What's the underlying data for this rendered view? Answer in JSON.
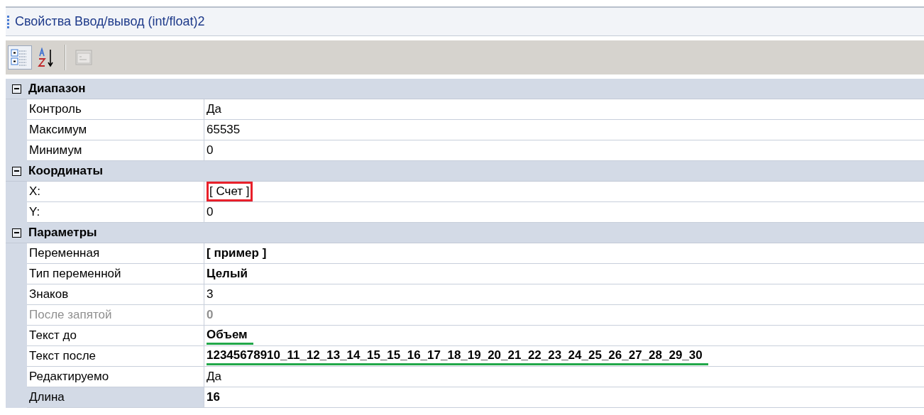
{
  "window": {
    "title": "Свойства Ввод/вывод (int/float)2"
  },
  "toolbar": [
    {
      "kind": "categorized",
      "selected": true,
      "disabled": false
    },
    {
      "kind": "alphabetical",
      "selected": false,
      "disabled": false
    },
    {
      "kind": "pages",
      "selected": false,
      "disabled": true
    }
  ],
  "categories": [
    {
      "name": "Диапазон",
      "expanded": true,
      "properties": [
        {
          "name": "Контроль",
          "value": "Да",
          "bold": false,
          "disabled": false,
          "selected": false
        },
        {
          "name": "Максимум",
          "value": "65535",
          "bold": false,
          "disabled": false,
          "selected": false
        },
        {
          "name": "Минимум",
          "value": "0",
          "bold": false,
          "disabled": false,
          "selected": false
        }
      ]
    },
    {
      "name": "Координаты",
      "expanded": true,
      "properties": [
        {
          "name": "X:",
          "value": "[ Счет ]",
          "bold": false,
          "disabled": false,
          "selected": false,
          "annotation": {
            "kind": "box",
            "color": "#e8202a"
          }
        },
        {
          "name": "Y:",
          "value": "0",
          "bold": false,
          "disabled": false,
          "selected": false
        }
      ]
    },
    {
      "name": "Параметры",
      "expanded": true,
      "properties": [
        {
          "name": "Переменная",
          "value": "[ пример ]",
          "bold": true,
          "disabled": false,
          "selected": false
        },
        {
          "name": "Тип переменной",
          "value": "Целый",
          "bold": true,
          "disabled": false,
          "selected": false
        },
        {
          "name": "Знаков",
          "value": "3",
          "bold": false,
          "disabled": false,
          "selected": false
        },
        {
          "name": "После запятой",
          "value": "0",
          "bold": true,
          "disabled": true,
          "selected": false
        },
        {
          "name": "Текст до",
          "value": "Объем",
          "bold": true,
          "disabled": false,
          "selected": false,
          "annotation": {
            "kind": "underline",
            "color": "#22a84a"
          }
        },
        {
          "name": "Текст после",
          "value": "12345678910_11_12_13_14_15_15_16_17_18_19_20_21_22_23_24_25_26_27_28_29_30",
          "bold": true,
          "disabled": false,
          "selected": false,
          "annotation": {
            "kind": "underline",
            "color": "#22a84a"
          }
        },
        {
          "name": "Редактируемо",
          "value": "Да",
          "bold": false,
          "disabled": false,
          "selected": false
        },
        {
          "name": "Длина",
          "value": "16",
          "bold": true,
          "disabled": false,
          "selected": true
        }
      ]
    }
  ]
}
